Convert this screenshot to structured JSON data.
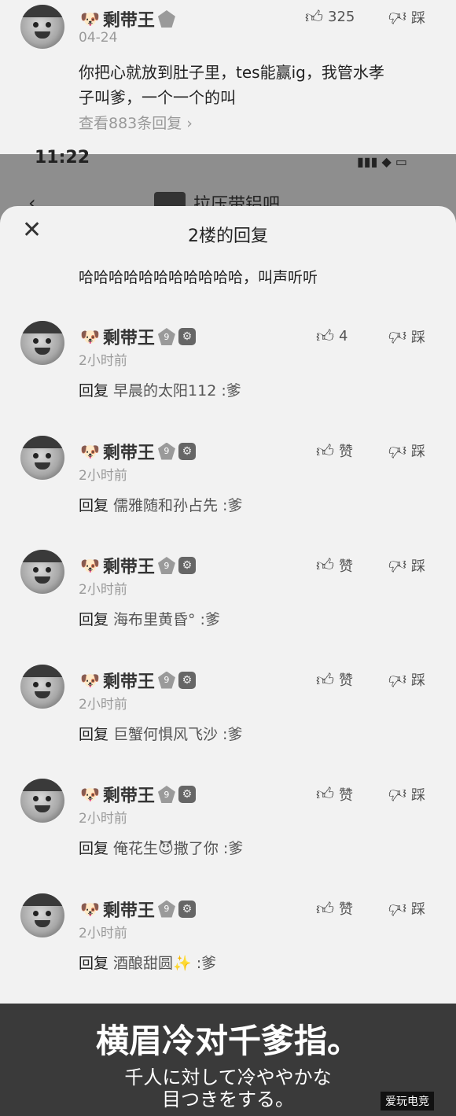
{
  "top_comment": {
    "user": "剩带王",
    "date": "04-24",
    "text_line1": "你把心就放到肚子里，tes能赢ig，我管水孝",
    "text_line2": "子叫爹，一个一个的叫",
    "view_replies": "查看883条回复 ›",
    "like_count": "325",
    "dislike_label": "踩"
  },
  "status_bar": {
    "time": "11:22"
  },
  "background_title": "拉压带铝吧",
  "sheet": {
    "title": "2楼的回复",
    "quote": "哈哈哈哈哈哈哈哈哈哈哈，叫声听听"
  },
  "replies": [
    {
      "user": "剩带王",
      "level": "9",
      "time": "2小时前",
      "reply_kw": "回复",
      "target": "早晨的太阳112 :爹",
      "like": "4",
      "dislike": "踩"
    },
    {
      "user": "剩带王",
      "level": "9",
      "time": "2小时前",
      "reply_kw": "回复",
      "target": "儒雅随和孙占先 :爹",
      "like": "赞",
      "dislike": "踩"
    },
    {
      "user": "剩带王",
      "level": "9",
      "time": "2小时前",
      "reply_kw": "回复",
      "target": "海布里黄昏° :爹",
      "like": "赞",
      "dislike": "踩"
    },
    {
      "user": "剩带王",
      "level": "9",
      "time": "2小时前",
      "reply_kw": "回复",
      "target": "巨蟹何惧风飞沙 :爹",
      "like": "赞",
      "dislike": "踩"
    },
    {
      "user": "剩带王",
      "level": "9",
      "time": "2小时前",
      "reply_kw": "回复",
      "target": "俺花生😈撒了你 :爹",
      "like": "赞",
      "dislike": "踩"
    },
    {
      "user": "剩带王",
      "level": "9",
      "time": "2小时前",
      "reply_kw": "回复",
      "target": "酒酿甜圆✨ :爹",
      "like": "赞",
      "dislike": "踩"
    }
  ],
  "subtitles": {
    "main": "横眉冷对千爹指。",
    "sub_line1": "千人に対して冷ややかな",
    "sub_line2": "目つきをする。"
  },
  "watermark": "爱玩电竞"
}
